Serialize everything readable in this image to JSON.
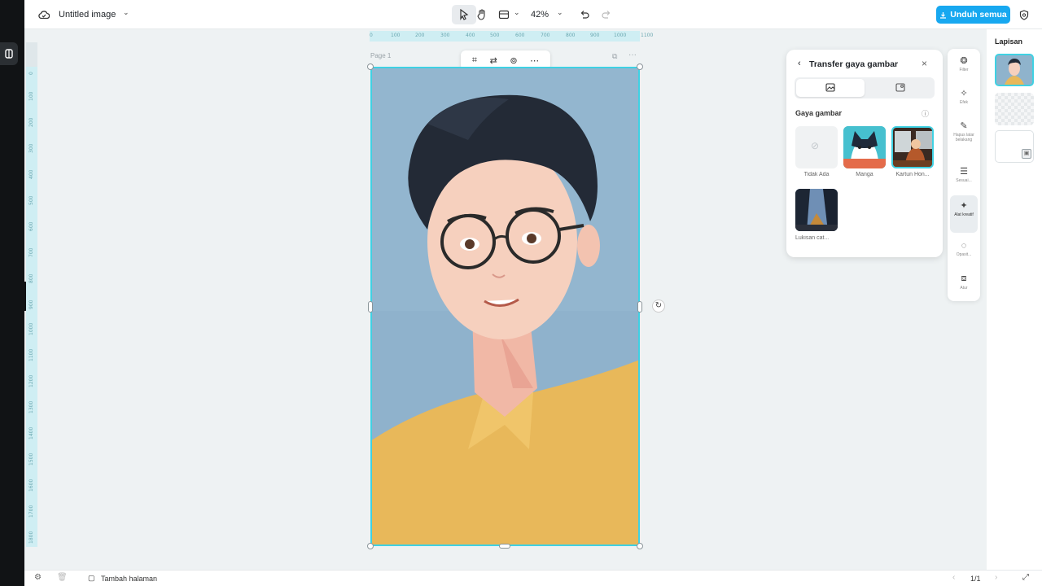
{
  "app": {
    "doc_title": "Untitled image",
    "zoom": "42%",
    "download_label": "Unduh semua"
  },
  "canvas": {
    "page_label": "Page 1"
  },
  "ruler": {
    "h_ticks": [
      "0",
      "100",
      "200",
      "300",
      "400",
      "500",
      "600",
      "700",
      "800",
      "900",
      "1000",
      "1100"
    ],
    "v_ticks": [
      "0",
      "100",
      "200",
      "300",
      "400",
      "500",
      "600",
      "700",
      "800",
      "900",
      "1000",
      "1100",
      "1200",
      "1300",
      "1400",
      "1500",
      "1600",
      "1700",
      "1800"
    ]
  },
  "style_panel": {
    "title": "Transfer gaya gambar",
    "section": "Gaya gambar",
    "styles": [
      {
        "label": "Tidak Ada"
      },
      {
        "label": "Manga"
      },
      {
        "label": "Kartun Hon..."
      },
      {
        "label": "Lukisan cat..."
      }
    ]
  },
  "tools": [
    {
      "name": "filter",
      "label": "Filter"
    },
    {
      "name": "efek",
      "label": "Efek"
    },
    {
      "name": "hapus",
      "label": "Hapus latar belakang"
    },
    {
      "name": "sesuaikan",
      "label": "Sesuai..."
    },
    {
      "name": "alat-kreatif",
      "label": "Alat kreatif"
    },
    {
      "name": "opasitas",
      "label": "Opasit..."
    },
    {
      "name": "atur",
      "label": "Atur"
    }
  ],
  "layers": {
    "title": "Lapisan"
  },
  "bottom": {
    "add_page": "Tambah halaman",
    "page_count": "1/1"
  },
  "colors": {
    "accent": "#17a8f0",
    "selection": "#3fd1e3",
    "left_strip": "#111315"
  }
}
